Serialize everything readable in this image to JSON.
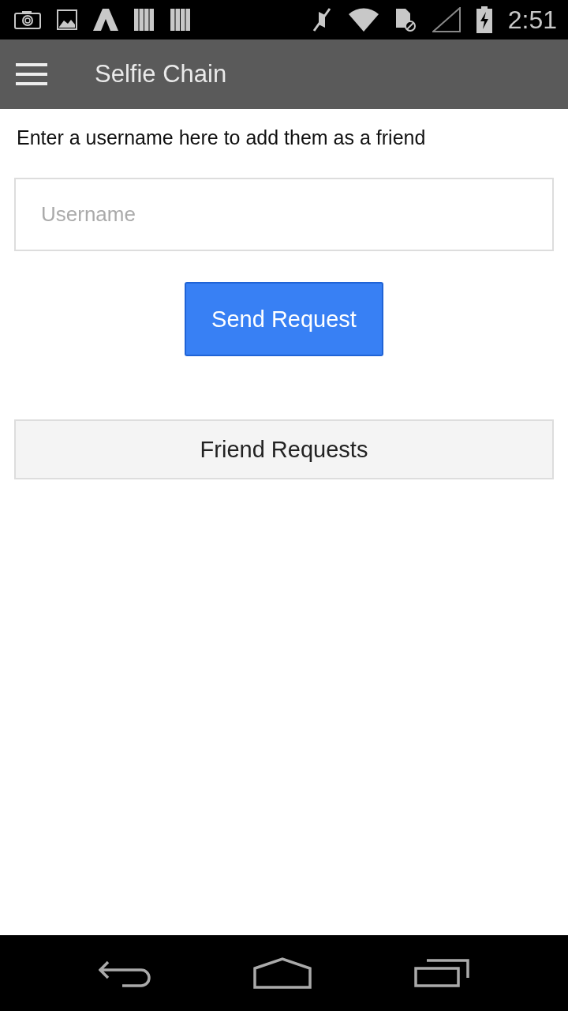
{
  "status_bar": {
    "time": "2:51"
  },
  "app_bar": {
    "title": "Selfie Chain"
  },
  "instruction": "Enter a username here to add them as a friend",
  "username_field": {
    "placeholder": "Username"
  },
  "send_button": {
    "label": "Send Request"
  },
  "friend_requests": {
    "label": "Friend Requests"
  }
}
